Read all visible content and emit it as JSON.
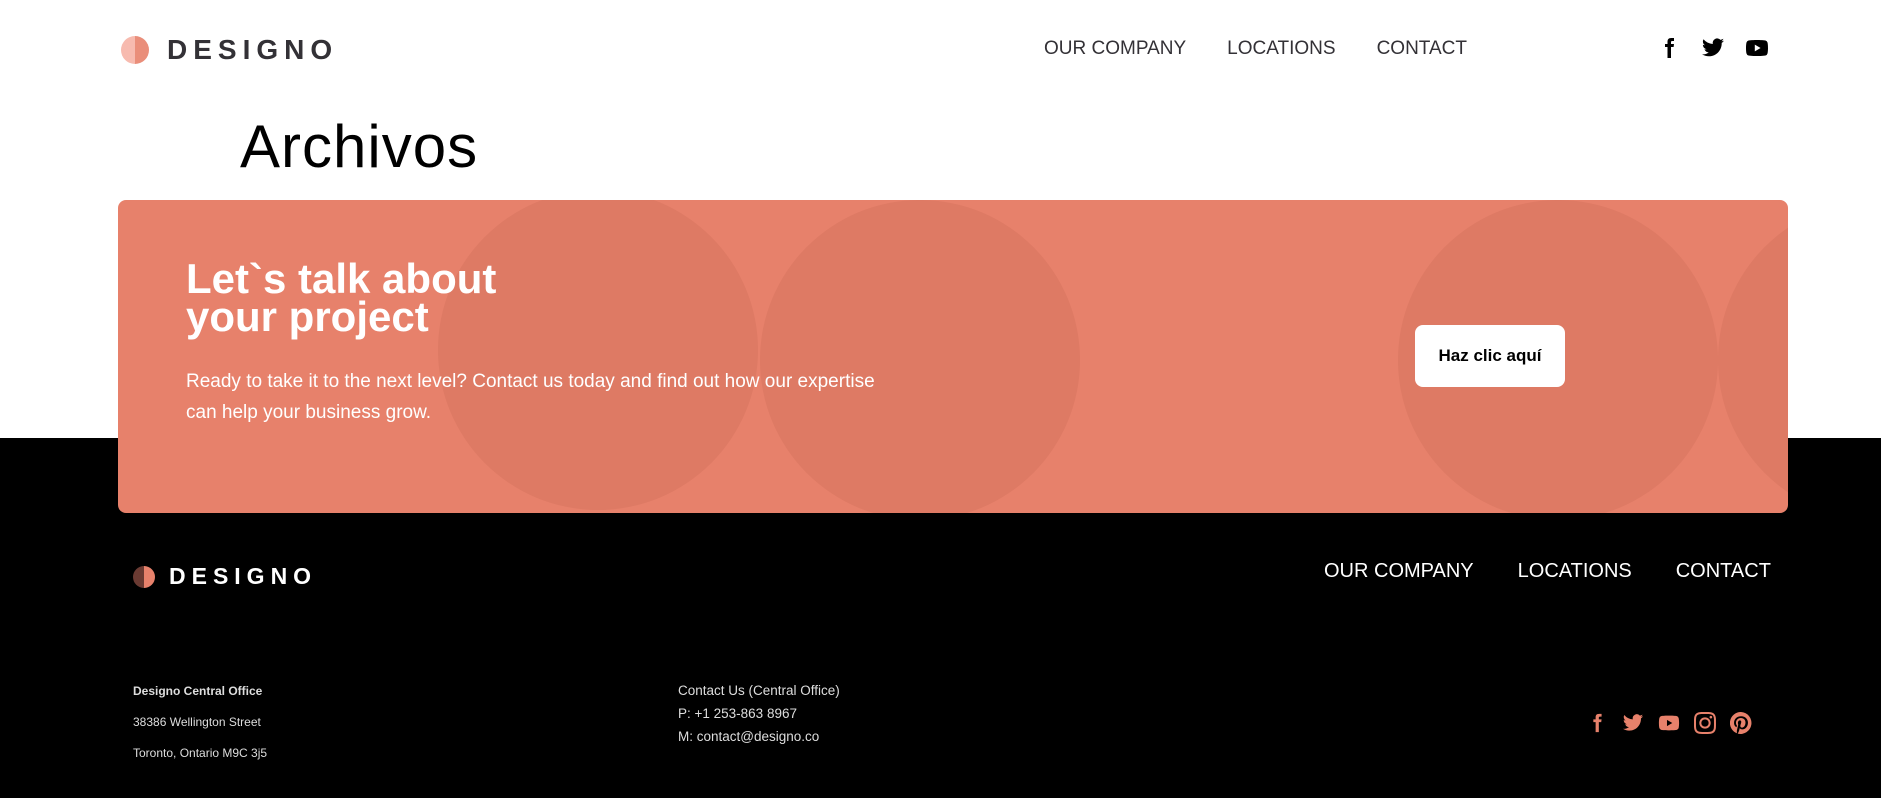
{
  "header": {
    "logo_text": "DESIGNO",
    "nav": [
      {
        "label": "OUR COMPANY"
      },
      {
        "label": "LOCATIONS"
      },
      {
        "label": "CONTACT"
      }
    ],
    "social_icons": [
      "facebook-icon",
      "twitter-icon",
      "youtube-icon"
    ]
  },
  "page": {
    "title": "Archivos"
  },
  "cta": {
    "heading_line1": "Let`s talk about",
    "heading_line2": "your project",
    "text": "Ready to take it to the next level? Contact us today and find out how our expertise can help your business grow.",
    "button_label": "Haz clic aquí"
  },
  "footer": {
    "logo_text": "DESIGNO",
    "nav": [
      {
        "label": "OUR COMPANY"
      },
      {
        "label": "LOCATIONS"
      },
      {
        "label": "CONTACT"
      }
    ],
    "office": {
      "name": "Designo Central Office",
      "street": "38386 Wellington Street",
      "city": "Toronto, Ontario M9C 3j5"
    },
    "contact": {
      "title": "Contact Us (Central Office)",
      "phone": "P: +1 253-863 8967",
      "email": "M: contact@designo.co"
    },
    "social_icons": [
      "facebook-icon",
      "twitter-icon",
      "youtube-icon",
      "instagram-icon",
      "pinterest-icon"
    ]
  },
  "colors": {
    "accent": "#e7816b",
    "dark": "#000000",
    "text_dark": "#333136"
  }
}
